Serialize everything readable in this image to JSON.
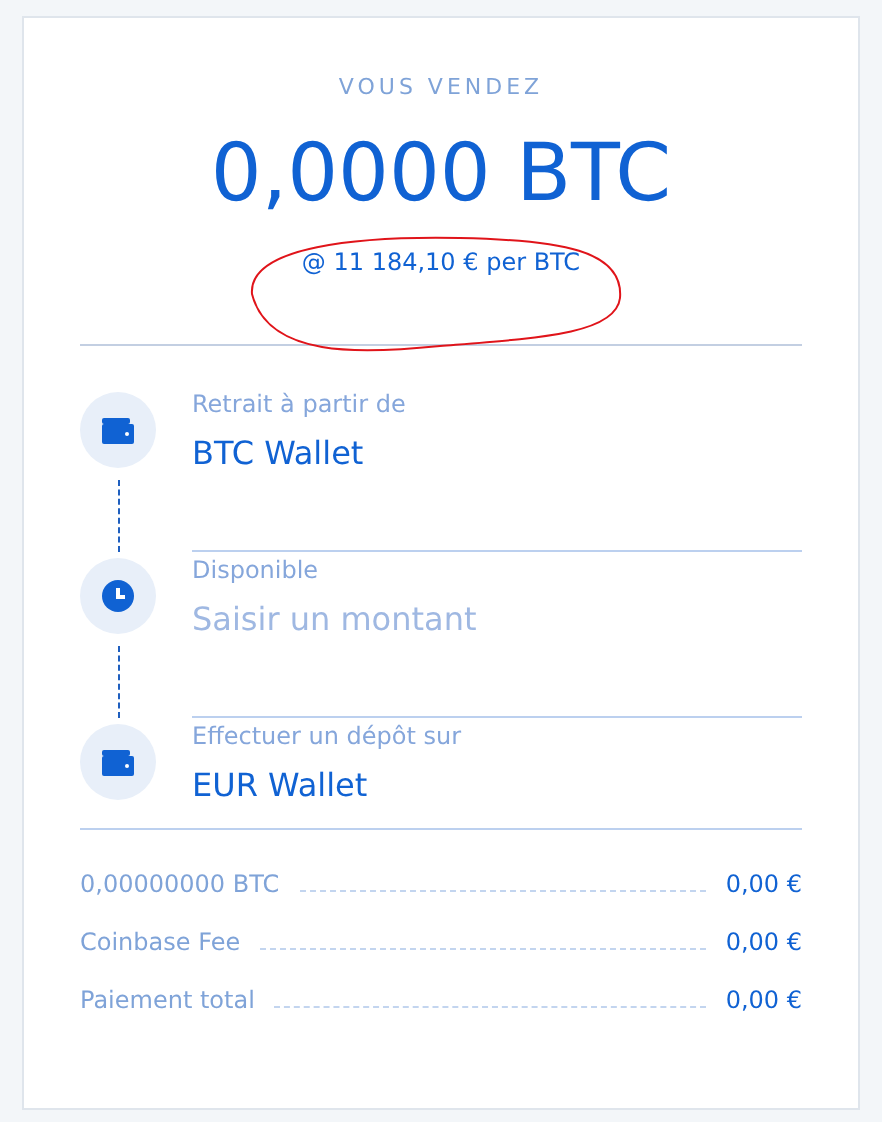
{
  "header": {
    "label": "VOUS VENDEZ",
    "amount": "0,0000 BTC",
    "rate": "@ 11 184,10 € per BTC",
    "rate_circled": true
  },
  "steps": [
    {
      "kind": "wallet",
      "label": "Retrait à partir de",
      "value": "BTC Wallet"
    },
    {
      "kind": "clock",
      "label": "Disponible",
      "placeholder": "Saisir un montant"
    },
    {
      "kind": "wallet",
      "label": "Effectuer un dépôt sur",
      "value": "EUR Wallet"
    }
  ],
  "summary": [
    {
      "label": "0,00000000 BTC",
      "amount": "0,00 €"
    },
    {
      "label": "Coinbase Fee",
      "amount": "0,00 €"
    },
    {
      "label": "Paiement total",
      "amount": "0,00 €"
    }
  ]
}
